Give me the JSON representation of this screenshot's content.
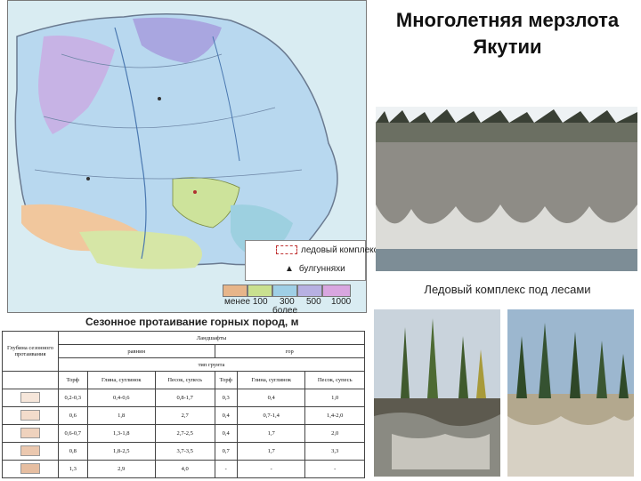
{
  "title": "Многолетняя мерзлота Якутии",
  "map": {
    "legend_ice": "ледовый комплекс",
    "legend_bulgunnyakhi": "булгунняхи",
    "scale_labels": [
      "менее 100",
      "300",
      "500",
      "1000"
    ],
    "scale_extra": "более",
    "subtitle": "Сезонное протаивание горных пород, м",
    "scale_colors": [
      "#e7b58a",
      "#c9e08f",
      "#9fcfe6",
      "#b7b0e2",
      "#d9a6e0"
    ]
  },
  "photos": {
    "caption": "Ледовый комплекс под лесами"
  },
  "table": {
    "landscape_header": "Ландшафты",
    "plain_header": "равнин",
    "mountain_header": "гор",
    "depth_header": "Глубина сезонного протаивания",
    "soil_type_header": "тип грунта",
    "soil_columns": [
      "Торф",
      "Глина, суглинок",
      "Песок, супесь",
      "Торф",
      "Глина, суглинок",
      "Песок, супесь"
    ],
    "rows": [
      [
        "0,2-0,3",
        "0,4-0,6",
        "0,8-1,7",
        "0,3",
        "0,4",
        "1,0"
      ],
      [
        "0,6",
        "1,8",
        "2,7",
        "0,4",
        "0,7-1,4",
        "1,4-2,0"
      ],
      [
        "0,6-0,7",
        "1,3-1,8",
        "2,7-2,5",
        "0,4",
        "1,7",
        "2,0"
      ],
      [
        "0,8",
        "1,8-2,5",
        "3,7-3,5",
        "0,7",
        "1,7",
        "3,3"
      ],
      [
        "1,3",
        "2,9",
        "4,0",
        "-",
        "-",
        "-"
      ]
    ]
  }
}
